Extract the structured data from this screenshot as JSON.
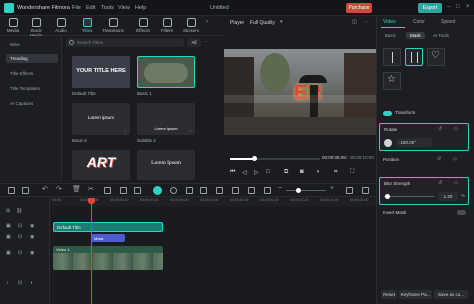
{
  "app": {
    "name": "Wondershare Filmora",
    "project_title": "Untitled",
    "purchase": "Purchase",
    "export": "Export"
  },
  "menu": [
    "File",
    "Edit",
    "Tools",
    "View",
    "Help"
  ],
  "toolbar": [
    {
      "label": "Media",
      "icon": "media-icon"
    },
    {
      "label": "Stock Media",
      "icon": "stock-media-icon"
    },
    {
      "label": "Audio",
      "icon": "audio-icon"
    },
    {
      "label": "Titles",
      "icon": "titles-icon",
      "active": true
    },
    {
      "label": "Transitions",
      "icon": "transitions-icon"
    },
    {
      "label": "Effects",
      "icon": "effects-icon"
    },
    {
      "label": "Filters",
      "icon": "filters-icon"
    },
    {
      "label": "Stickers",
      "icon": "stickers-icon"
    }
  ],
  "sidebar": {
    "items": [
      "Mine",
      "Trending",
      "Title Effects",
      "Title Templates",
      "AI Captions"
    ],
    "active_index": 1
  },
  "search": {
    "placeholder": "Search Titles",
    "filter": "All"
  },
  "titles": [
    {
      "name": "Default Title",
      "thumb_text": "YOUR TITLE HERE"
    },
    {
      "name": "Basic 1",
      "thumb_text": ""
    },
    {
      "name": "Basic 6",
      "thumb_text": "Lorem ipsum"
    },
    {
      "name": "Subtitle 2",
      "thumb_text": "Lorem ipsum"
    },
    {
      "name": "",
      "thumb_text": "ART"
    },
    {
      "name": "",
      "thumb_text": "Lorem Ipsum"
    }
  ],
  "player": {
    "label": "Player",
    "quality": "Full Quality",
    "current_time": "00:00:05:05",
    "total_time": "00:00:10:00",
    "overlay_text": "ER"
  },
  "right_panel": {
    "tabs": [
      "Video",
      "Color",
      "Speed"
    ],
    "subtabs": [
      "Basic",
      "Mask",
      "AI Tools"
    ],
    "transform_label": "Transform",
    "rotate_label": "Rotate",
    "rotate_value": "-180.00°",
    "position_label": "Position",
    "blur_label": "Blur Strength",
    "blur_value": "1.20",
    "blur_unit": "%",
    "invert_label": "Invert Mask",
    "reset": "Reset",
    "keyframe": "Keyframe Pa...",
    "save_custom": "Save as cu..."
  },
  "timeline": {
    "ruler": [
      "00:00",
      "00:00:00:05",
      "00:00:00:10",
      "00:00:00:15",
      "00:00:00:20",
      "00:00:01:00",
      "00:00:01:05",
      "00:00:01:10",
      "00:00:01:15",
      "00:00:01:20",
      "00:00:02:00"
    ],
    "title_clip": "Default Title",
    "effect_clip": "Mask",
    "video_clip": "Video 1"
  }
}
